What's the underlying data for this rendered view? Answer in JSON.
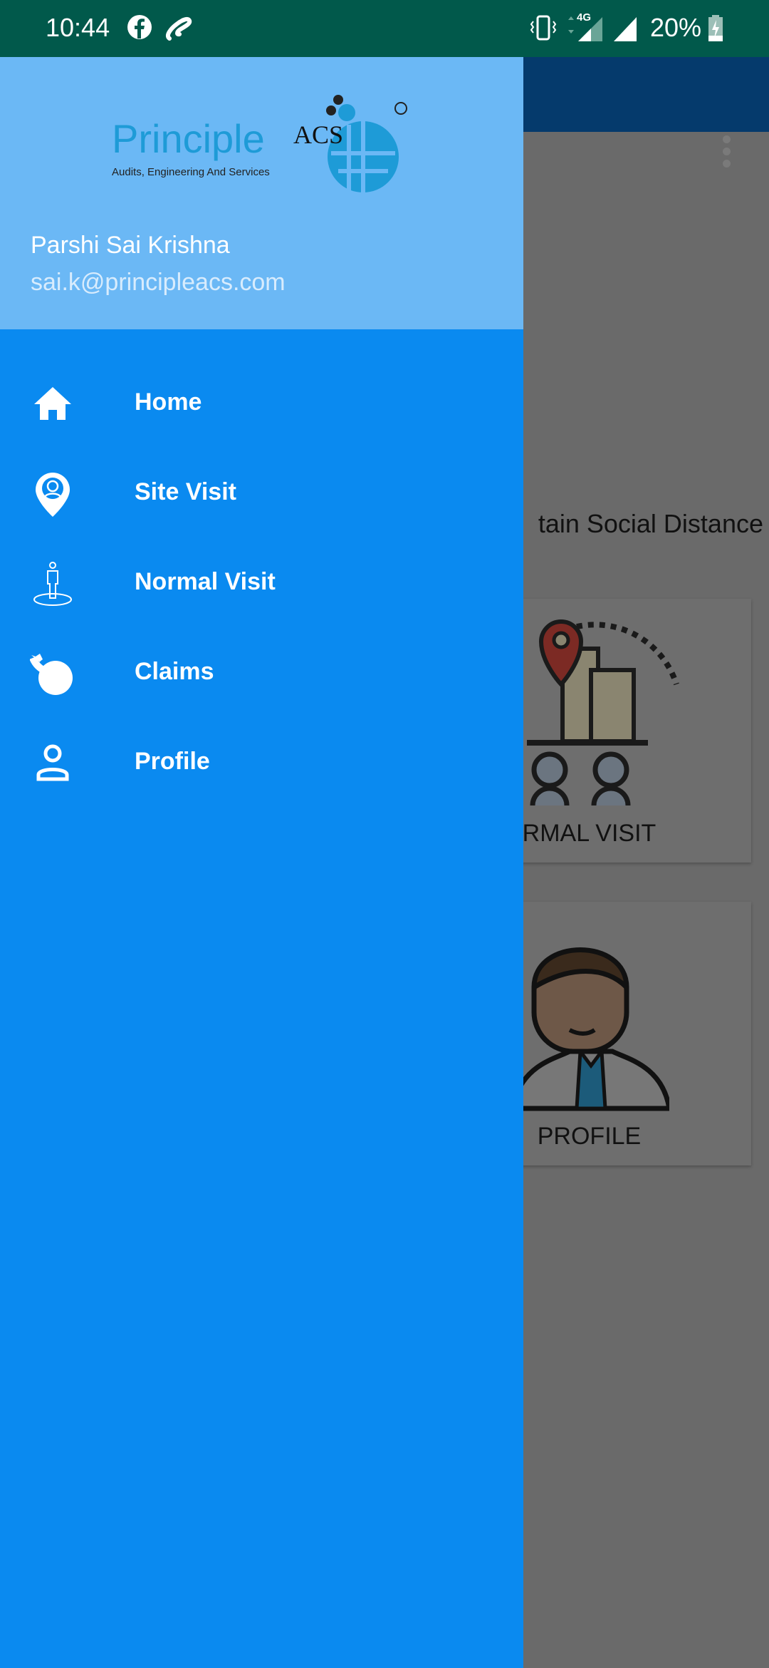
{
  "status_bar": {
    "time": "10:44",
    "network": "4G",
    "battery": "20%",
    "icons": [
      "facebook-icon",
      "airtel-icon",
      "vibrate-icon",
      "signal-4g-icon",
      "signal-icon",
      "battery-charging-icon"
    ]
  },
  "background": {
    "headline_visible": "tain Social Distance",
    "cards": [
      {
        "label_visible": "RMAL VISIT"
      },
      {
        "label_visible": "PROFILE"
      }
    ]
  },
  "drawer": {
    "logo": {
      "brand": "Principle",
      "brand_suffix": "ACS",
      "tagline": "Audits, Engineering And Services"
    },
    "user": {
      "name": "Parshi Sai Krishna",
      "email": "sai.k@principleacs.com"
    },
    "items": [
      {
        "label": "Home",
        "icon": "home-icon"
      },
      {
        "label": "Site Visit",
        "icon": "location-person-icon"
      },
      {
        "label": "Normal Visit",
        "icon": "person-standing-icon"
      },
      {
        "label": "Claims",
        "icon": "money-bag-icon"
      },
      {
        "label": "Profile",
        "icon": "person-icon"
      }
    ]
  },
  "colors": {
    "status_bar": "#01594b",
    "drawer_header": "#6bb8f5",
    "drawer_body": "#0a8af0",
    "scrim": "#6a6a6a",
    "app_bar": "#053a6c"
  }
}
